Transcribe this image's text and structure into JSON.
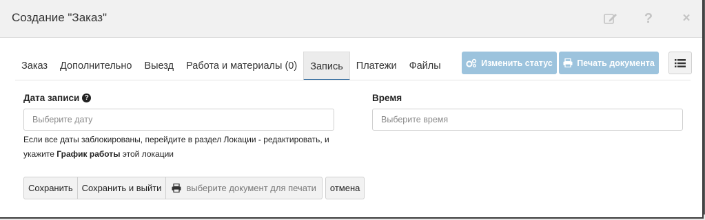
{
  "modal": {
    "title": "Создание \"Заказ\""
  },
  "header_icons": [
    "edit-icon",
    "help-icon",
    "close-icon"
  ],
  "tabs": [
    {
      "label": "Заказ"
    },
    {
      "label": "Дополнительно"
    },
    {
      "label": "Выезд"
    },
    {
      "label": "Работа и материалы (0)"
    },
    {
      "label": "Запись"
    },
    {
      "label": "Платежи"
    },
    {
      "label": "Файлы"
    }
  ],
  "active_tab": "Запись",
  "toolbar": {
    "change_status_label": "Изменить статус",
    "print_doc_label": "Печать документа"
  },
  "form": {
    "date_label": "Дата записи",
    "date_placeholder": "Выберите дату",
    "time_label": "Время",
    "time_placeholder": "Выберите время",
    "hint_part1": "Если все даты заблокированы, перейдите в раздел Локации - редактировать, и укажите ",
    "hint_bold": "График работы",
    "hint_part2": " этой локации"
  },
  "actions": {
    "save_label": "Сохранить",
    "save_exit_label": "Сохранить и выйти",
    "doc_select_label": "выберите документ для печати",
    "cancel_label": "отмена"
  },
  "colors": {
    "primary_disabled": "#9cc3dd",
    "active_tab_underline": "#2f6a9d"
  }
}
